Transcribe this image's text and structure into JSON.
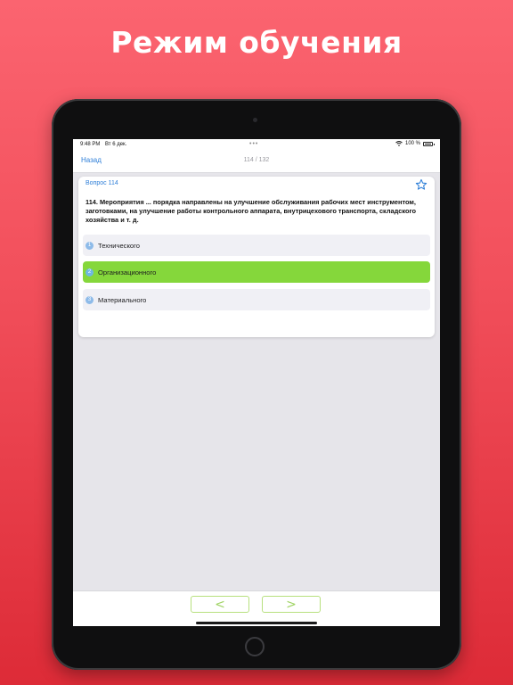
{
  "promo": {
    "title": "Режим обучения"
  },
  "status_bar": {
    "time": "9:48 PM",
    "date": "Вт 6 дек.",
    "battery": "100 %",
    "dots": "•••"
  },
  "nav": {
    "back_label": "Назад",
    "counter": "114 / 132"
  },
  "question": {
    "label": "Вопрос 114",
    "text": "114. Мероприятия ... порядка направлены на улучшение обслуживания рабочих мест инструментом, заготовками, на улучшение работы контрольного аппарата, внутрицехового транспорта, складского хозяйства и т. д.",
    "answers": [
      {
        "num": "1",
        "text": "Технического"
      },
      {
        "num": "2",
        "text": "Организационного"
      },
      {
        "num": "3",
        "text": "Материального"
      }
    ]
  },
  "toolbar": {
    "prev_label": "<",
    "next_label": ">"
  },
  "colors": {
    "accent": "#2f7fd8",
    "correct": "#85d73b",
    "background_top": "#fb6470",
    "background_bottom": "#dd2b37"
  }
}
